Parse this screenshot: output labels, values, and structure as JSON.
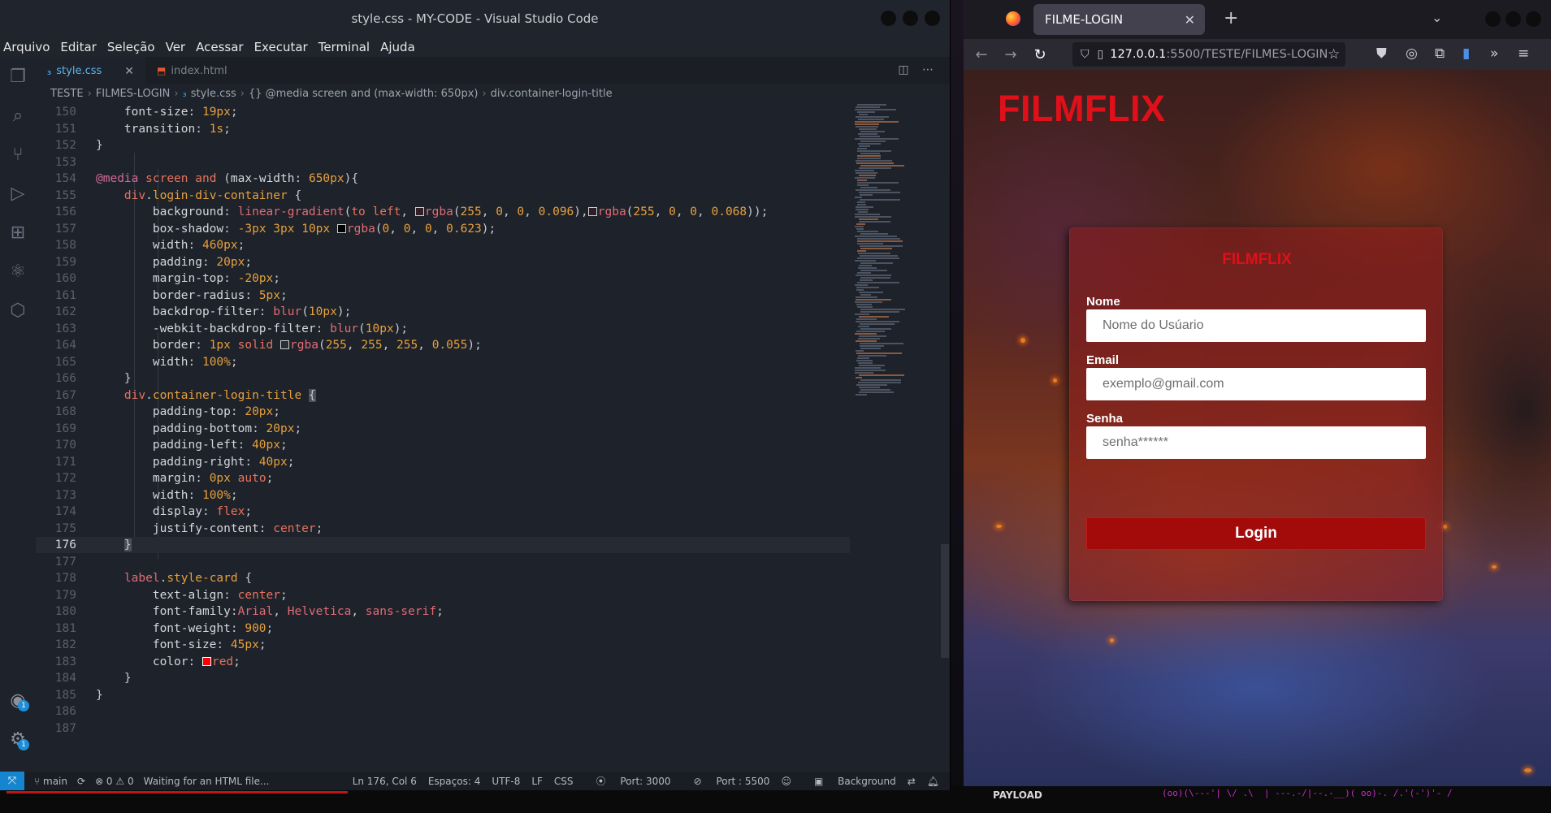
{
  "vscode": {
    "window_title": "style.css - MY-CODE - Visual Studio Code",
    "menu": [
      "Arquivo",
      "Editar",
      "Seleção",
      "Ver",
      "Acessar",
      "Executar",
      "Terminal",
      "Ajuda"
    ],
    "tabs": [
      {
        "label": "style.css",
        "icon": "css-icon",
        "active": true
      },
      {
        "label": "index.html",
        "icon": "html-icon",
        "active": false
      }
    ],
    "breadcrumb": [
      "TESTE",
      "FILMES-LOGIN",
      "style.css",
      "{} @media screen and (max-width: 650px)",
      "div.container-login-title"
    ],
    "current_line": 176,
    "code": [
      {
        "n": "150",
        "html": "    <span class='c-prop'>font-size</span>: <span class='c-num'>19px</span>;"
      },
      {
        "n": "151",
        "html": "    <span class='c-prop'>transition</span>: <span class='c-num'>1s</span>;"
      },
      {
        "n": "152",
        "html": "}"
      },
      {
        "n": "153",
        "html": ""
      },
      {
        "n": "154",
        "html": "<span class='c-at'>@media</span> <span class='c-sel'>screen</span> <span class='c-sel'>and</span> (<span class='c-prop'>max-width</span>: <span class='c-num'>650px</span>){"
      },
      {
        "n": "155",
        "html": "    <span class='c-sel'>div</span>.<span class='c-val'>login-div-container</span> {"
      },
      {
        "n": "156",
        "html": "        <span class='c-prop'>background</span>: <span class='c-fn'>linear-gradient</span>(<span class='c-sel'>to left</span>, <i class='swatch' style='background:rgba(255,0,0,0.096)'></i><span class='c-fn'>rgba</span>(<span class='c-num'>255</span>, <span class='c-num'>0</span>, <span class='c-num'>0</span>, <span class='c-num'>0.096</span>),<i class='swatch' style='background:rgba(255,0,0,0.068)'></i><span class='c-fn'>rgba</span>(<span class='c-num'>255</span>, <span class='c-num'>0</span>, <span class='c-num'>0</span>, <span class='c-num'>0.068</span>));"
      },
      {
        "n": "157",
        "html": "        <span class='c-prop'>box-shadow</span>: <span class='c-num'>-3px</span> <span class='c-num'>3px</span> <span class='c-num'>10px</span> <i class='swatch' style='background:#000'></i><span class='c-fn'>rgba</span>(<span class='c-num'>0</span>, <span class='c-num'>0</span>, <span class='c-num'>0</span>, <span class='c-num'>0.623</span>);"
      },
      {
        "n": "158",
        "html": "        <span class='c-prop'>width</span>: <span class='c-num'>460px</span>;"
      },
      {
        "n": "159",
        "html": "        <span class='c-prop'>padding</span>: <span class='c-num'>20px</span>;"
      },
      {
        "n": "160",
        "html": "        <span class='c-prop'>margin-top</span>: <span class='c-num'>-20px</span>;"
      },
      {
        "n": "161",
        "html": "        <span class='c-prop'>border-radius</span>: <span class='c-num'>5px</span>;"
      },
      {
        "n": "162",
        "html": "        <span class='c-prop'>backdrop-filter</span>: <span class='c-fn'>blur</span>(<span class='c-num'>10px</span>);"
      },
      {
        "n": "163",
        "html": "        <span class='c-prop'>-webkit-backdrop-filter</span>: <span class='c-fn'>blur</span>(<span class='c-num'>10px</span>);"
      },
      {
        "n": "164",
        "html": "        <span class='c-prop'>border</span>: <span class='c-num'>1px</span> <span class='c-sel'>solid</span> <i class='swatch' style='background:rgba(255,255,255,0.055)'></i><span class='c-fn'>rgba</span>(<span class='c-num'>255</span>, <span class='c-num'>255</span>, <span class='c-num'>255</span>, <span class='c-num'>0.055</span>);"
      },
      {
        "n": "165",
        "html": "        <span class='c-prop'>width</span>: <span class='c-num'>100%</span>;"
      },
      {
        "n": "166",
        "html": "    }"
      },
      {
        "n": "167",
        "html": "    <span class='c-sel'>div</span>.<span class='c-val'>container-login-title</span> <span style='background:#4a4f5a'>{</span>"
      },
      {
        "n": "168",
        "html": "        <span class='c-prop'>padding-top</span>: <span class='c-num'>20px</span>;"
      },
      {
        "n": "169",
        "html": "        <span class='c-prop'>padding-bottom</span>: <span class='c-num'>20px</span>;"
      },
      {
        "n": "170",
        "html": "        <span class='c-prop'>padding-left</span>: <span class='c-num'>40px</span>;"
      },
      {
        "n": "171",
        "html": "        <span class='c-prop'>padding-right</span>: <span class='c-num'>40px</span>;"
      },
      {
        "n": "172",
        "html": "        <span class='c-prop'>margin</span>: <span class='c-num'>0px</span> <span class='c-sel'>auto</span>;"
      },
      {
        "n": "173",
        "html": "        <span class='c-prop'>width</span>: <span class='c-num'>100%</span>;"
      },
      {
        "n": "174",
        "html": "        <span class='c-prop'>display</span>: <span class='c-sel'>flex</span>;"
      },
      {
        "n": "175",
        "html": "        <span class='c-prop'>justify-content</span>: <span class='c-sel'>center</span>;"
      },
      {
        "n": "176",
        "html": "    <span style='background:#4a4f5a'>}</span>"
      },
      {
        "n": "177",
        "html": ""
      },
      {
        "n": "178",
        "html": "    <span class='c-fn'>label</span>.<span class='c-val'>style-card</span> {"
      },
      {
        "n": "179",
        "html": "        <span class='c-prop'>text-align</span>: <span class='c-sel'>center</span>;"
      },
      {
        "n": "180",
        "html": "        <span class='c-prop'>font-family</span>:<span class='c-fn'>Arial</span>, <span class='c-fn'>Helvetica</span>, <span class='c-fn'>sans-serif</span>;"
      },
      {
        "n": "181",
        "html": "        <span class='c-prop'>font-weight</span>: <span class='c-num'>900</span>;"
      },
      {
        "n": "182",
        "html": "        <span class='c-prop'>font-size</span>: <span class='c-num'>45px</span>;"
      },
      {
        "n": "183",
        "html": "        <span class='c-prop'>color</span>: <i class='swatch' style='background:red;border-color:#fff'></i><span class='c-sel'>red</span>;"
      },
      {
        "n": "184",
        "html": "    }"
      },
      {
        "n": "185",
        "html": "}"
      },
      {
        "n": "186",
        "html": ""
      },
      {
        "n": "187",
        "html": ""
      }
    ],
    "status": {
      "branch": "main",
      "problems": "⊗ 0 ⚠ 0",
      "message": "Waiting for an HTML file...",
      "position": "Ln 176, Col 6",
      "spaces": "Espaços: 4",
      "encoding": "UTF-8",
      "eol": "LF",
      "language": "CSS",
      "port1": "Port: 3000",
      "port2": "Port : 5500",
      "background": "Background"
    }
  },
  "firefox": {
    "tab_title": "FILME-LOGIN",
    "url_host": "127.0.0.1",
    "url_rest": ":5500/TESTE/FILMES-LOGIN",
    "page": {
      "logo": "FILMFLIX",
      "card_title": "FILMFLIX",
      "name_label": "Nome",
      "name_placeholder": "Nome do Usúario",
      "email_label": "Email",
      "email_placeholder": "exemplo@gmail.com",
      "password_label": "Senha",
      "password_placeholder": "senha******",
      "login_button": "Login",
      "brand_color": "#e0101a"
    }
  },
  "desktop": {
    "bottom_label": "PAYLOAD"
  }
}
